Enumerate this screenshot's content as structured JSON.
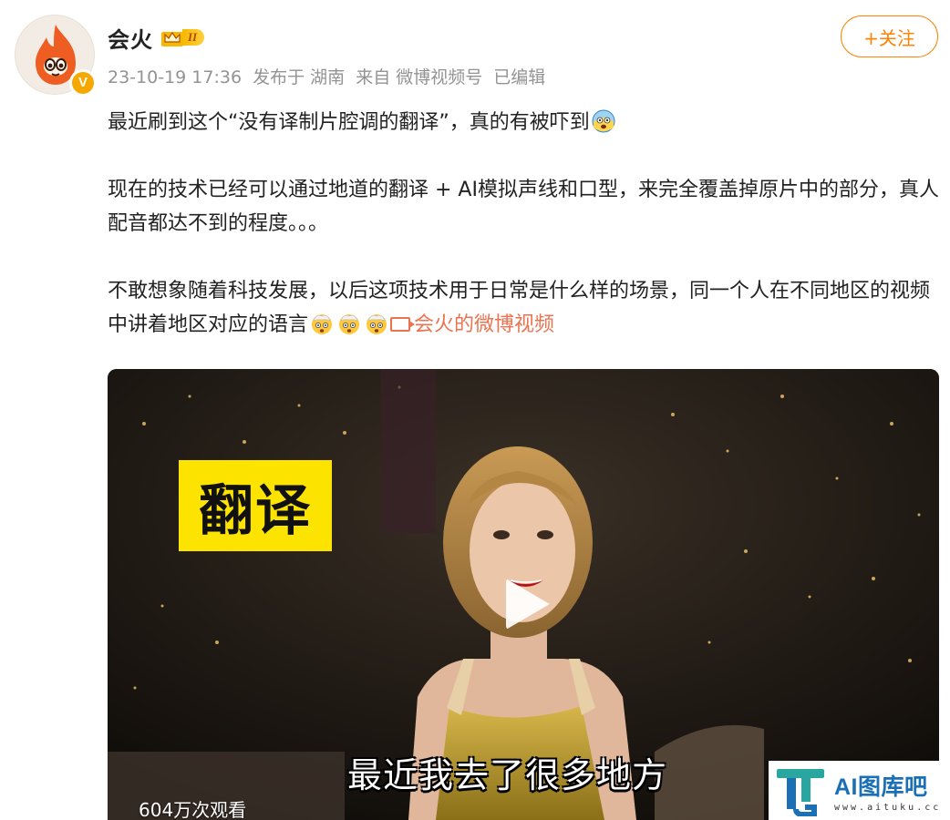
{
  "post": {
    "author": {
      "name": "会火",
      "level_badge": "II",
      "verified_mark": "V"
    },
    "follow_label": "+关注",
    "meta": {
      "time": "23-10-19 17:36",
      "location": "发布于 湖南",
      "source": "来自 微博视频号",
      "edited": "已编辑"
    },
    "paragraphs": {
      "p1": "最近刷到这个“没有译制片腔调的翻译”，真的有被吓到",
      "p2": "现在的技术已经可以通过地道的翻译 + AI模拟声线和口型，来完全覆盖掉原片中的部分，真人配音都达不到的程度。。。",
      "p3": "不敢想象随着科技发展，以后这项技术用于日常是什么样的场景，同一个人在不同地区的视频中讲着地区对应的语言"
    },
    "video_link_label": "会火的微博视频",
    "video": {
      "overlay_caption": "翻译",
      "subtitle": "最近我去了很多地方",
      "views": "604万次观看"
    }
  },
  "watermark": {
    "title": "AI图库吧",
    "url": "www.aituku.cc"
  },
  "icons": {
    "avatar": "flame-mascot-icon",
    "emoji_p1": "scared-face-emoji",
    "emoji_p3": "exploding-head-emoji",
    "link": "video-link-icon",
    "play": "play-icon"
  },
  "colors": {
    "accent": "#ff8200",
    "link": "#eb7350",
    "meta": "#939393",
    "caption_bg": "#fde400",
    "verified": "#f7a800"
  }
}
